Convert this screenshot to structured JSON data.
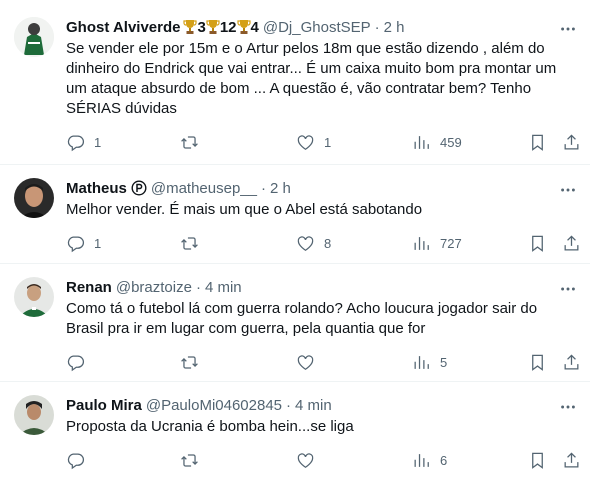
{
  "tweets": [
    {
      "name": "Ghost Alviverde",
      "name_extras": [
        "3",
        "12",
        "4"
      ],
      "handle": "@Dj_GhostSEP",
      "time": "2 h",
      "text": "Se vender ele por 15m e o Artur pelos 18m que estão dizendo , além do dinheiro do Endrick que vai entrar... É um caixa muito bom pra montar um um ataque absurdo de bom ... A questão é, vão contratar bem? Tenho SÉRIAS dúvidas",
      "replies": "1",
      "retweets": "",
      "likes": "1",
      "views": "459"
    },
    {
      "name": "Matheus",
      "handle": "@matheusep__",
      "time": "2 h",
      "text": "Melhor vender. É mais um que o Abel está sabotando",
      "replies": "1",
      "retweets": "",
      "likes": "8",
      "views": "727"
    },
    {
      "name": "Renan",
      "handle": "@braztoize",
      "time": "4 min",
      "text": "Como tá o futebol lá com guerra rolando? Acho loucura jogador sair do Brasil pra ir em lugar com guerra, pela quantia que for",
      "replies": "",
      "retweets": "",
      "likes": "",
      "views": "5"
    },
    {
      "name": "Paulo Mira",
      "handle": "@PauloMi04602845",
      "time": "4 min",
      "text": "Proposta da Ucrania é bomba hein...se liga",
      "replies": "",
      "retweets": "",
      "likes": "",
      "views": "6"
    }
  ],
  "separator": "·",
  "icons": {
    "reply": "reply-icon",
    "retweet": "retweet-icon",
    "like": "heart-icon",
    "views": "views-icon",
    "bookmark": "bookmark-icon",
    "share": "share-icon",
    "more": "more-icon",
    "trophy": "trophy-icon",
    "badge": "circled-p-icon"
  },
  "colors": {
    "text": "#0f1419",
    "secondary": "#536471",
    "divider": "#eff3f4",
    "trophy": "#d4a017"
  }
}
